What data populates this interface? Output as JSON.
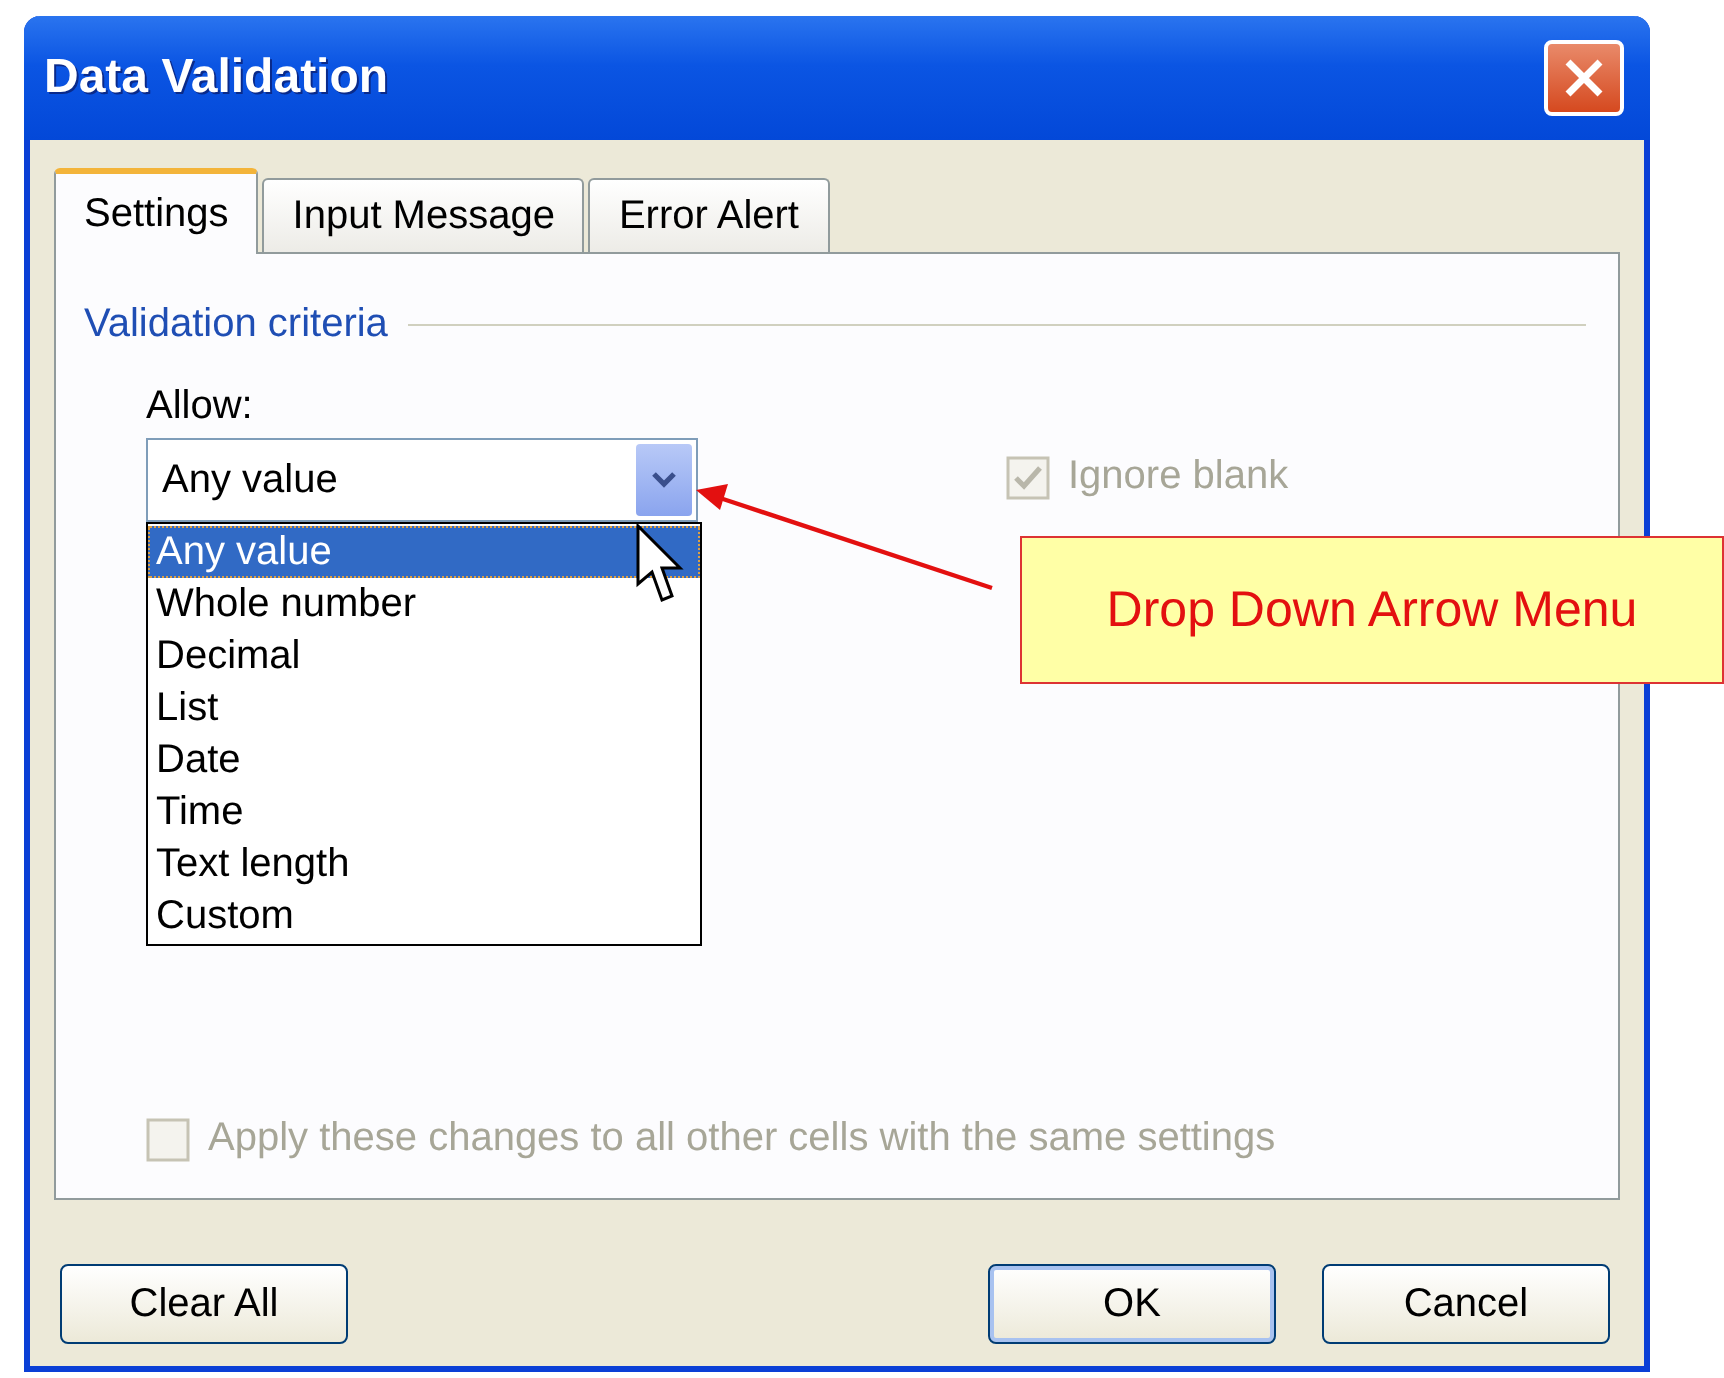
{
  "window": {
    "title": "Data Validation"
  },
  "tabs": [
    {
      "label": "Settings",
      "selected": true
    },
    {
      "label": "Input Message",
      "selected": false
    },
    {
      "label": "Error Alert",
      "selected": false
    }
  ],
  "section": {
    "title": "Validation criteria"
  },
  "allow": {
    "label": "Allow:",
    "value": "Any value",
    "expanded": true,
    "options": [
      {
        "label": "Any value",
        "selected": true
      },
      {
        "label": "Whole number",
        "selected": false
      },
      {
        "label": "Decimal",
        "selected": false
      },
      {
        "label": "List",
        "selected": false
      },
      {
        "label": "Date",
        "selected": false
      },
      {
        "label": "Time",
        "selected": false
      },
      {
        "label": "Text length",
        "selected": false
      },
      {
        "label": "Custom",
        "selected": false
      }
    ]
  },
  "ignore_blank": {
    "label": "Ignore blank",
    "checked": true,
    "disabled": true
  },
  "apply_all": {
    "label": "Apply these changes to all other cells with the same settings",
    "checked": false,
    "disabled": true
  },
  "buttons": [
    {
      "label": "Clear All",
      "default": false
    },
    {
      "label": "OK",
      "default": true
    },
    {
      "label": "Cancel",
      "default": false
    }
  ],
  "callout": {
    "text": "Drop Down Arrow Menu"
  }
}
